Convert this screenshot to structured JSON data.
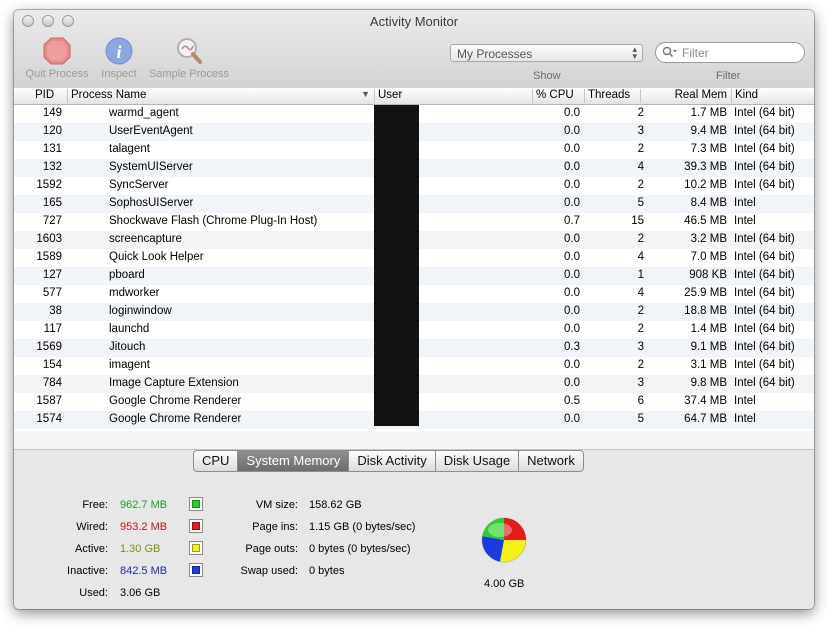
{
  "window": {
    "title": "Activity Monitor"
  },
  "toolbar": {
    "quit_label": "Quit Process",
    "inspect_label": "Inspect",
    "sample_label": "Sample Process",
    "show_select_value": "My Processes",
    "show_label": "Show",
    "filter_placeholder": "Filter",
    "filter_label": "Filter"
  },
  "table": {
    "headers": {
      "pid": "PID",
      "name": "Process Name",
      "user": "User",
      "cpu": "% CPU",
      "threads": "Threads",
      "mem": "Real Mem",
      "kind": "Kind"
    },
    "rows": [
      {
        "pid": "149",
        "name": "warmd_agent",
        "cpu": "0.0",
        "threads": "2",
        "mem": "1.7 MB",
        "kind": "Intel (64 bit)"
      },
      {
        "pid": "120",
        "name": "UserEventAgent",
        "cpu": "0.0",
        "threads": "3",
        "mem": "9.4 MB",
        "kind": "Intel (64 bit)"
      },
      {
        "pid": "131",
        "name": "talagent",
        "cpu": "0.0",
        "threads": "2",
        "mem": "7.3 MB",
        "kind": "Intel (64 bit)"
      },
      {
        "pid": "132",
        "name": "SystemUIServer",
        "cpu": "0.0",
        "threads": "4",
        "mem": "39.3 MB",
        "kind": "Intel (64 bit)"
      },
      {
        "pid": "1592",
        "name": "SyncServer",
        "cpu": "0.0",
        "threads": "2",
        "mem": "10.2 MB",
        "kind": "Intel (64 bit)"
      },
      {
        "pid": "165",
        "name": "SophosUIServer",
        "cpu": "0.0",
        "threads": "5",
        "mem": "8.4 MB",
        "kind": "Intel"
      },
      {
        "pid": "727",
        "name": "Shockwave Flash (Chrome Plug-In Host)",
        "cpu": "0.7",
        "threads": "15",
        "mem": "46.5 MB",
        "kind": "Intel"
      },
      {
        "pid": "1603",
        "name": "screencapture",
        "cpu": "0.0",
        "threads": "2",
        "mem": "3.2 MB",
        "kind": "Intel (64 bit)"
      },
      {
        "pid": "1589",
        "name": "Quick Look Helper",
        "cpu": "0.0",
        "threads": "4",
        "mem": "7.0 MB",
        "kind": "Intel (64 bit)"
      },
      {
        "pid": "127",
        "name": "pboard",
        "cpu": "0.0",
        "threads": "1",
        "mem": "908 KB",
        "kind": "Intel (64 bit)"
      },
      {
        "pid": "577",
        "name": "mdworker",
        "cpu": "0.0",
        "threads": "4",
        "mem": "25.9 MB",
        "kind": "Intel (64 bit)"
      },
      {
        "pid": "38",
        "name": "loginwindow",
        "cpu": "0.0",
        "threads": "2",
        "mem": "18.8 MB",
        "kind": "Intel (64 bit)"
      },
      {
        "pid": "117",
        "name": "launchd",
        "cpu": "0.0",
        "threads": "2",
        "mem": "1.4 MB",
        "kind": "Intel (64 bit)"
      },
      {
        "pid": "1569",
        "name": "Jitouch",
        "cpu": "0.3",
        "threads": "3",
        "mem": "9.1 MB",
        "kind": "Intel (64 bit)"
      },
      {
        "pid": "154",
        "name": "imagent",
        "cpu": "0.0",
        "threads": "2",
        "mem": "3.1 MB",
        "kind": "Intel (64 bit)"
      },
      {
        "pid": "784",
        "name": "Image Capture Extension",
        "cpu": "0.0",
        "threads": "3",
        "mem": "9.8 MB",
        "kind": "Intel (64 bit)"
      },
      {
        "pid": "1587",
        "name": "Google Chrome Renderer",
        "cpu": "0.5",
        "threads": "6",
        "mem": "37.4 MB",
        "kind": "Intel"
      },
      {
        "pid": "1574",
        "name": "Google Chrome Renderer",
        "cpu": "0.0",
        "threads": "5",
        "mem": "64.7 MB",
        "kind": "Intel"
      }
    ]
  },
  "tabs": [
    {
      "label": "CPU",
      "active": false
    },
    {
      "label": "System Memory",
      "active": true
    },
    {
      "label": "Disk Activity",
      "active": false
    },
    {
      "label": "Disk Usage",
      "active": false
    },
    {
      "label": "Network",
      "active": false
    }
  ],
  "memory": {
    "free": {
      "label": "Free:",
      "value": "962.7 MB",
      "color": "#1f9e1f",
      "swatch": "#2ad02a"
    },
    "wired": {
      "label": "Wired:",
      "value": "953.2 MB",
      "color": "#c01818",
      "swatch": "#e41c1c"
    },
    "active": {
      "label": "Active:",
      "value": "1.30 GB",
      "color": "#8a8a1c",
      "swatch": "#f3f01a"
    },
    "inactive": {
      "label": "Inactive:",
      "value": "842.5 MB",
      "color": "#1c2ea8",
      "swatch": "#1c3ae0"
    },
    "used": {
      "label": "Used:",
      "value": "3.06 GB"
    },
    "vm_size": {
      "label": "VM size:",
      "value": "158.62 GB"
    },
    "page_ins": {
      "label": "Page ins:",
      "value": "1.15 GB (0 bytes/sec)"
    },
    "page_outs": {
      "label": "Page outs:",
      "value": "0 bytes (0 bytes/sec)"
    },
    "swap_used": {
      "label": "Swap used:",
      "value": "0 bytes"
    },
    "total": "4.00 GB"
  }
}
